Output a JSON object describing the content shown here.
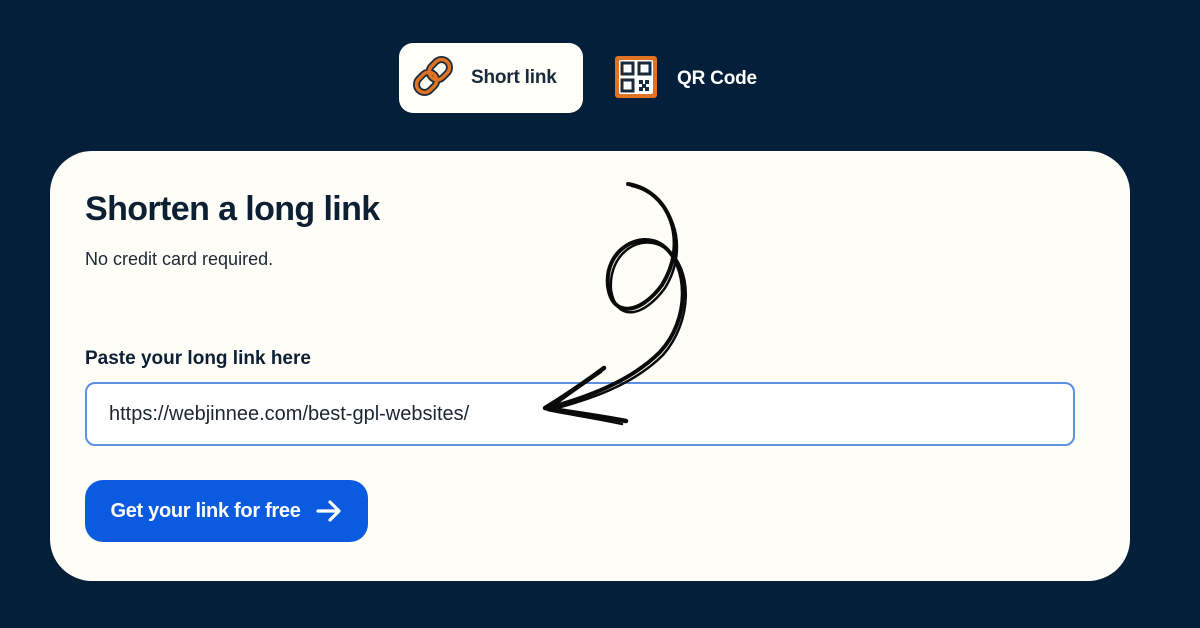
{
  "tabs": {
    "short_link": {
      "label": "Short link",
      "icon": "link-icon",
      "active": true
    },
    "qr_code": {
      "label": "QR Code",
      "icon": "qr-code-icon",
      "active": false
    }
  },
  "card": {
    "title": "Shorten a long link",
    "subtitle": "No credit card required.",
    "input_label": "Paste your long link here",
    "input_value": "https://webjinnee.com/best-gpl-websites/",
    "button_label": "Get your link for free",
    "button_icon": "arrow-right-icon"
  },
  "colors": {
    "background": "#031f39",
    "card": "#fffdf7",
    "accent": "#0b5be0",
    "icon_orange": "#e07322",
    "input_border": "#5c8fe0"
  }
}
